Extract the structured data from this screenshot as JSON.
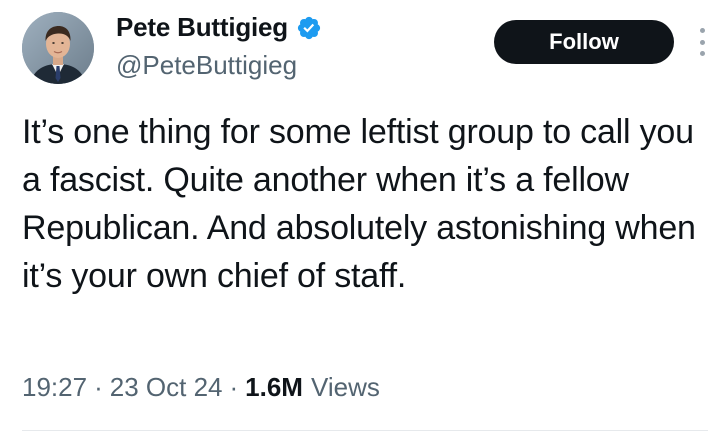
{
  "author": {
    "display_name": "Pete Buttigieg",
    "handle": "@PeteButtigieg",
    "verified": true,
    "verified_icon": "verified-badge-icon",
    "verified_color": "#1d9bf0",
    "avatar_icon": "profile-photo"
  },
  "actions": {
    "follow_label": "Follow",
    "more_icon": "vertical-ellipsis-icon"
  },
  "tweet": {
    "text": "It’s one thing for some leftist group to call you a fascist. Quite another when it’s a fellow Republican. And absolutely astonishing when it’s your own chief of staff.",
    "time": "19:27",
    "separator": "·",
    "date": "23 Oct 24",
    "views_count": "1.6M",
    "views_label": "Views"
  },
  "colors": {
    "text_primary": "#0f1419",
    "text_secondary": "#536471",
    "button_bg": "#0f1419",
    "button_text": "#ffffff"
  }
}
